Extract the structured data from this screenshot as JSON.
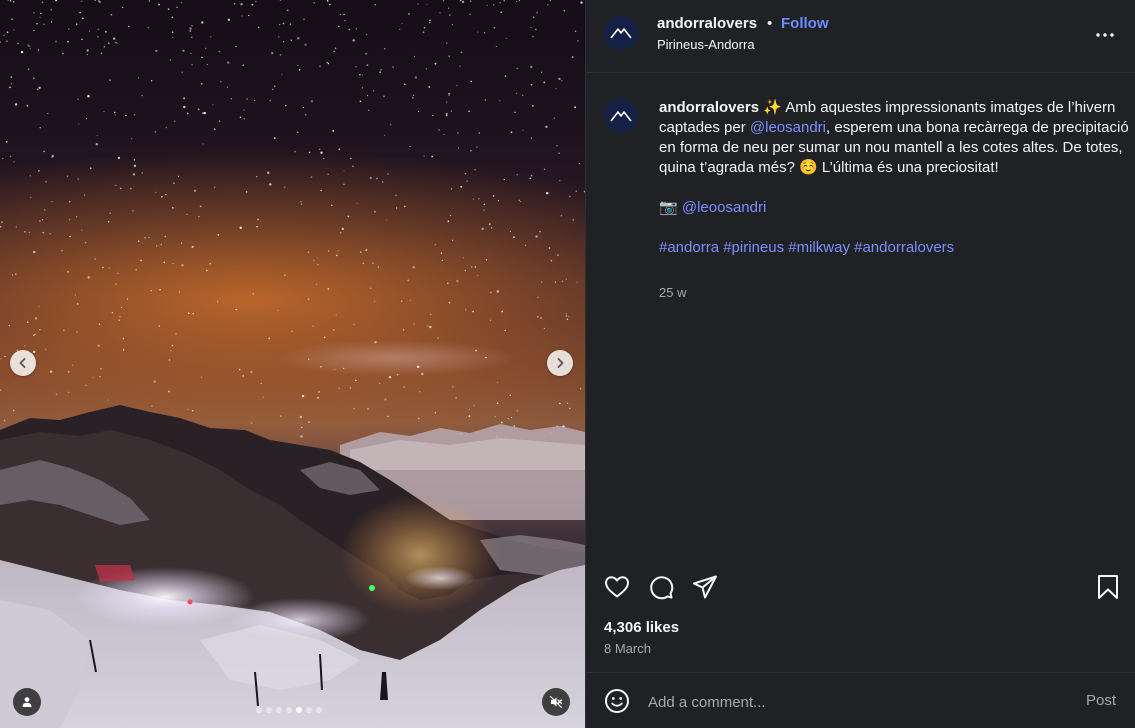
{
  "media": {
    "carousel_total": 7,
    "carousel_active_index": 4
  },
  "header": {
    "username": "andorralovers",
    "separator": "•",
    "follow_label": "Follow",
    "location": "Pirineus-Andorra"
  },
  "caption": {
    "username": "andorralovers",
    "line1_text_a": " ✨ Amb aquestes impressionants imatges de l’hivern captades per ",
    "mention1": "@leosandri",
    "line1_text_b": ", esperem una bona recàrrega de precipitació en forma de neu per sumar un nou mantell a les cotes altes. De totes, quina t’agrada més? ☺️ L’última és una preciositat!",
    "camera_emoji": "📷",
    "mention2": "@leoosandri",
    "hashtags": [
      "#andorra",
      "#pirineus",
      "#milkway",
      "#andorralovers"
    ],
    "timestamp": "25 w"
  },
  "actions": {
    "likes": "4,306 likes",
    "date": "8 March"
  },
  "comment_box": {
    "placeholder": "Add a comment...",
    "post_label": "Post"
  },
  "icons": {
    "avatar": "mountain-logo-icon",
    "more": "more-horizontal-icon",
    "like": "heart-icon",
    "comment": "comment-bubble-icon",
    "share": "paper-plane-icon",
    "save": "bookmark-icon",
    "emoji": "smiley-icon",
    "tag": "person-icon",
    "mute": "speaker-muted-icon",
    "prev": "chevron-left-icon",
    "next": "chevron-right-icon"
  },
  "colors": {
    "accent": "#6e8cff",
    "panel_bg": "#1f2125",
    "avatar_bg": "#142046"
  }
}
